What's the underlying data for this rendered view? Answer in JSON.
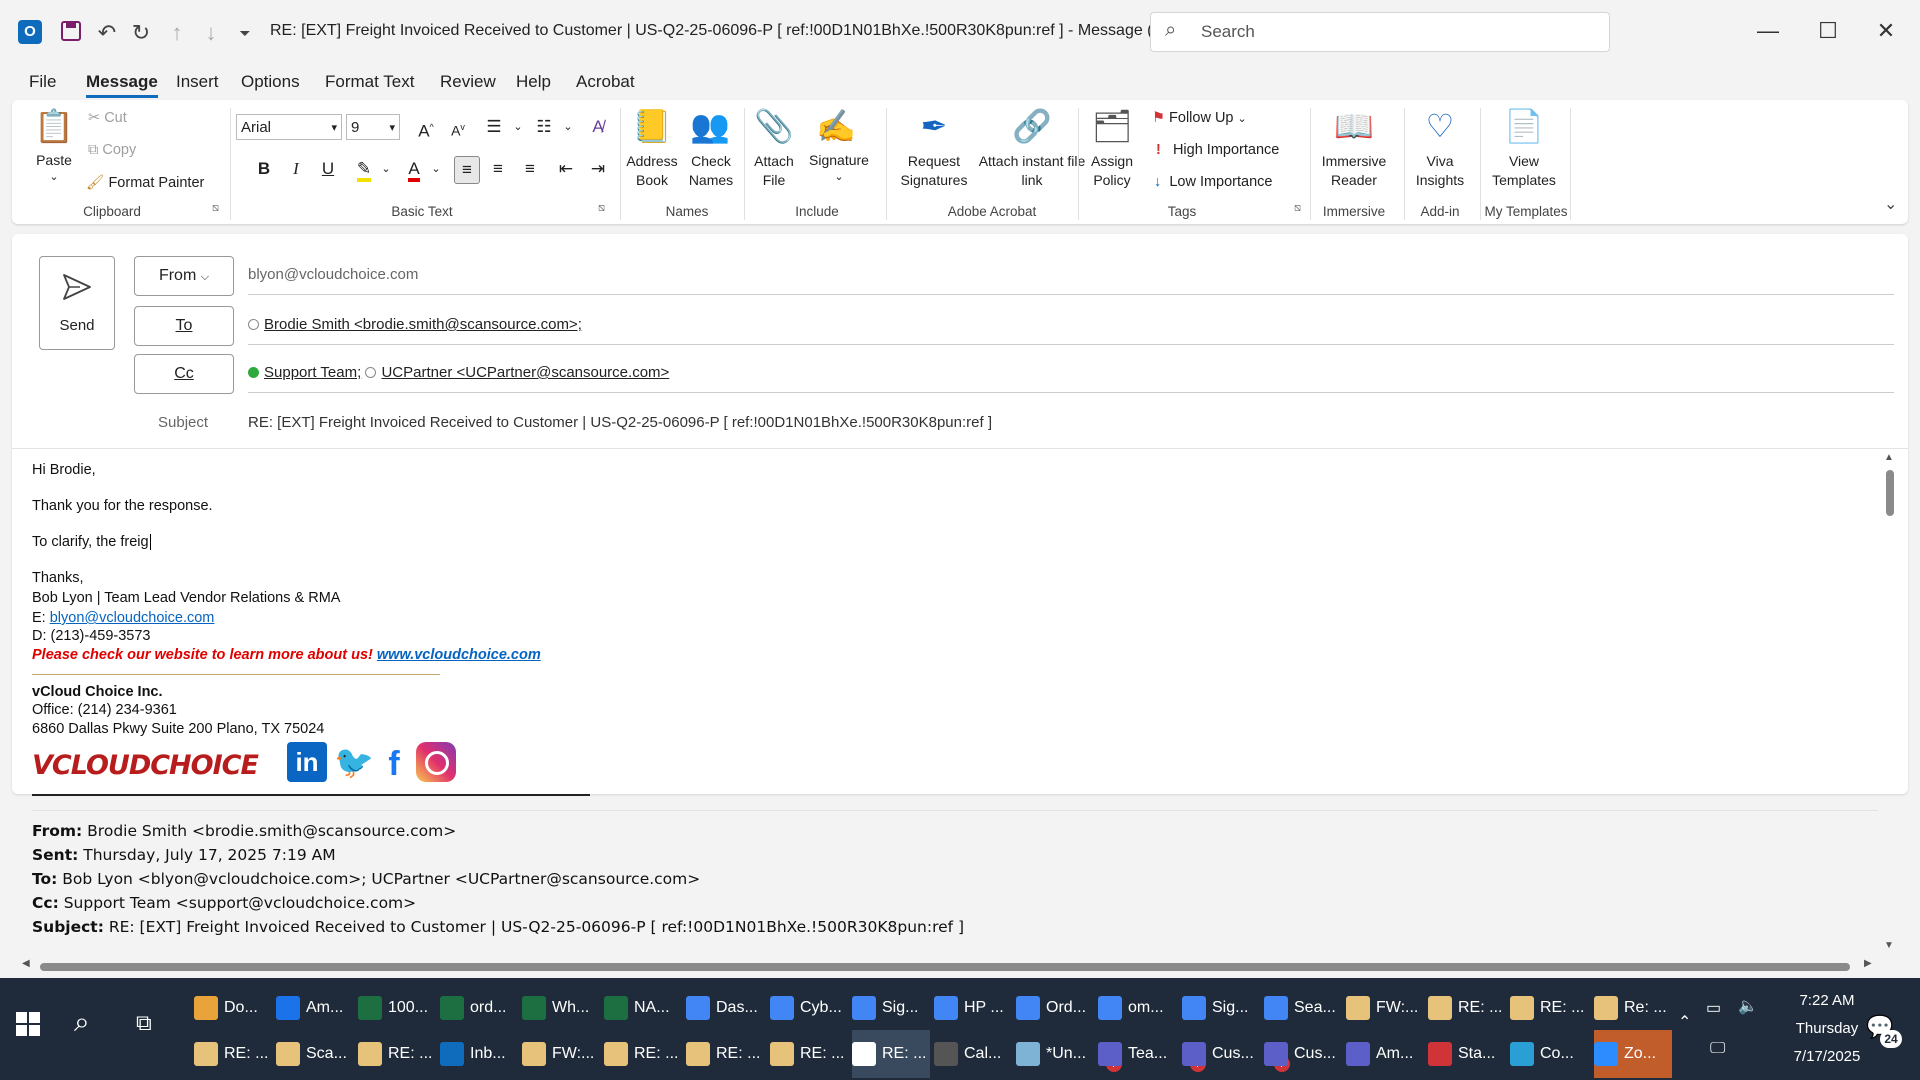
{
  "window": {
    "title": "RE: [EXT] Freight Invoiced Received to Customer | US-Q2-25-06096-P    [ ref:!00D1N01BhXe.!500R30K8pun:ref ]  -  Message (HT...",
    "search_placeholder": "Search"
  },
  "menu": [
    "File",
    "Message",
    "Insert",
    "Options",
    "Format Text",
    "Review",
    "Help",
    "Acrobat"
  ],
  "ribbon": {
    "clipboard": {
      "paste": "Paste",
      "cut": "Cut",
      "copy": "Copy",
      "format_painter": "Format Painter",
      "group": "Clipboard"
    },
    "basic_text": {
      "font": "Arial",
      "size": "9",
      "group": "Basic Text"
    },
    "names": {
      "address_book": "Address Book",
      "check_names": "Check Names",
      "group": "Names"
    },
    "include": {
      "attach_file": "Attach File",
      "signature": "Signature",
      "group": "Include"
    },
    "adobe": {
      "request_signatures": "Request Signatures",
      "attach_instant": "Attach instant file link",
      "group": "Adobe Acrobat"
    },
    "tags": {
      "assign_policy": "Assign Policy",
      "follow_up": "Follow Up",
      "high_importance": "High Importance",
      "low_importance": "Low Importance",
      "group": "Tags"
    },
    "immersive": {
      "reader": "Immersive Reader",
      "group": "Immersive"
    },
    "addin": {
      "viva": "Viva Insights",
      "group": "Add-in"
    },
    "templates": {
      "view": "View Templates",
      "group": "My Templates"
    }
  },
  "compose": {
    "send": "Send",
    "from_label": "From",
    "from_value": "blyon@vcloudchoice.com",
    "to_label": "To",
    "to_value": "Brodie Smith <brodie.smith@scansource.com>;",
    "cc_label": "Cc",
    "cc_1": "Support Team;",
    "cc_2": "UCPartner <UCPartner@scansource.com>",
    "subject_label": "Subject",
    "subject_value": "RE: [EXT] Freight Invoiced Received to Customer | US-Q2-25-06096-P    [ ref:!00D1N01BhXe.!500R30K8pun:ref ]"
  },
  "body": {
    "greeting": "Hi Brodie,",
    "line1": "Thank you for the response.",
    "line2": "To clarify, the freig",
    "thanks": "Thanks,",
    "sig_name": "Bob Lyon | Team Lead Vendor Relations & RMA",
    "sig_email_label": "E: ",
    "sig_email": "blyon@vcloudchoice.com",
    "sig_phone": "D: (213)-459-3573",
    "sig_website_text": "Please check our website to learn more about us! ",
    "sig_website": "www.vcloudchoice.com",
    "company": "vCloud Choice Inc.",
    "office": "Office: (214) 234-9361",
    "address": "6860 Dallas Pkwy Suite 200 Plano, TX 75024",
    "logo_text": "VCLOUDCHOICE",
    "orig_from_label": "From:",
    "orig_from": " Brodie Smith <brodie.smith@scansource.com>",
    "orig_sent_label": "Sent:",
    "orig_sent": " Thursday, July 17, 2025 7:19 AM",
    "orig_to_label": "To:",
    "orig_to": " Bob Lyon <blyon@vcloudchoice.com>; UCPartner <UCPartner@scansource.com>",
    "orig_cc_label": "Cc:",
    "orig_cc": " Support Team <support@vcloudchoice.com>",
    "orig_subject_label": "Subject:",
    "orig_subject": " RE: [EXT] Freight Invoiced Received to Customer | US-Q2-25-06096-P [ ref:!00D1N01BhXe.!500R30K8pun:ref ]"
  },
  "taskbar": {
    "row1": [
      "Do...",
      "Am...",
      "100...",
      "ord...",
      "Wh...",
      "NA...",
      "Das...",
      "Cyb...",
      "Sig...",
      "HP ...",
      "Ord...",
      "om...",
      "Sig...",
      "Sea...",
      "FW:...",
      "RE: ...",
      "RE: ...",
      "Re: ..."
    ],
    "row2": [
      "RE: ...",
      "Sca...",
      "RE: ...",
      "Inb...",
      "FW:...",
      "RE: ...",
      "RE: ...",
      "RE: ...",
      "RE: ...",
      "Cal...",
      "*Un...",
      "Tea...",
      "Cus...",
      "Cus...",
      "Am...",
      "Sta...",
      "Co...",
      "Zo..."
    ],
    "time": "7:22 AM",
    "day": "Thursday",
    "date": "7/17/2025",
    "notif_count": "24",
    "badge_7": "7",
    "badge_3": "3"
  }
}
